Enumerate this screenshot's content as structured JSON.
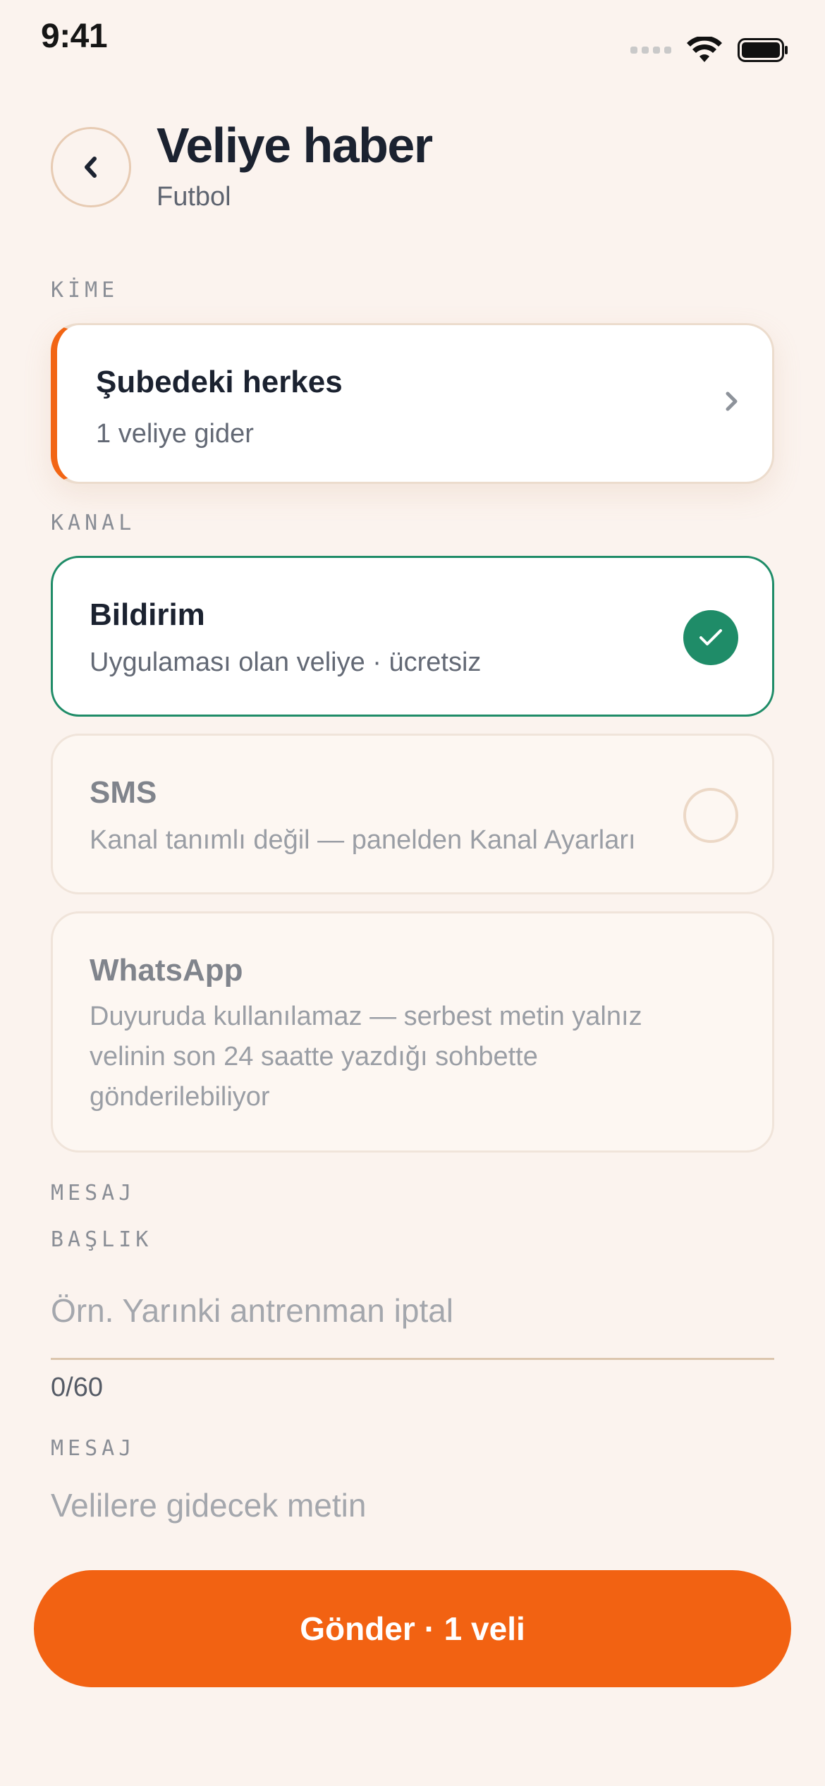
{
  "status_bar": {
    "time": "9:41",
    "icons": [
      "cellular-signal-icon",
      "wifi-icon",
      "battery-icon"
    ]
  },
  "header": {
    "back_icon": "chevron-left-icon",
    "title": "Veliye haber",
    "subtitle": "Futbol"
  },
  "recipient": {
    "section_label": "KİME",
    "title": "Şubedeki herkes",
    "subtitle": "1 veliye gider",
    "icon": "chevron-right-icon"
  },
  "channel": {
    "section_label": "KANAL",
    "options": [
      {
        "title": "Bildirim",
        "subtitle": "Uygulaması olan veliye · ücretsiz",
        "selected": true,
        "enabled": true
      },
      {
        "title": "SMS",
        "subtitle": "Kanal tanımlı değil — panelden Kanal Ayarları",
        "selected": false,
        "enabled": false
      },
      {
        "title": "WhatsApp",
        "subtitle": "Duyuruda kullanılamaz — serbest metin yalnız velinin son 24 saatte yazdığı sohbette gönderilebiliyor",
        "selected": false,
        "enabled": false
      }
    ]
  },
  "message": {
    "section_label": "MESAJ",
    "title_label": "BAŞLIK",
    "title_placeholder": "Örn. Yarınki antrenman iptal",
    "title_value": "",
    "title_counter": "0/60",
    "body_label": "MESAJ",
    "body_placeholder": "Velilere gidecek metin",
    "body_value": ""
  },
  "send_button": {
    "label": "Gönder · 1 veli"
  },
  "colors": {
    "background": "#fbf3ee",
    "accent_orange": "#f26212",
    "selected_green": "#1f8c68",
    "text_primary": "#1b2230",
    "text_secondary": "#636975"
  }
}
